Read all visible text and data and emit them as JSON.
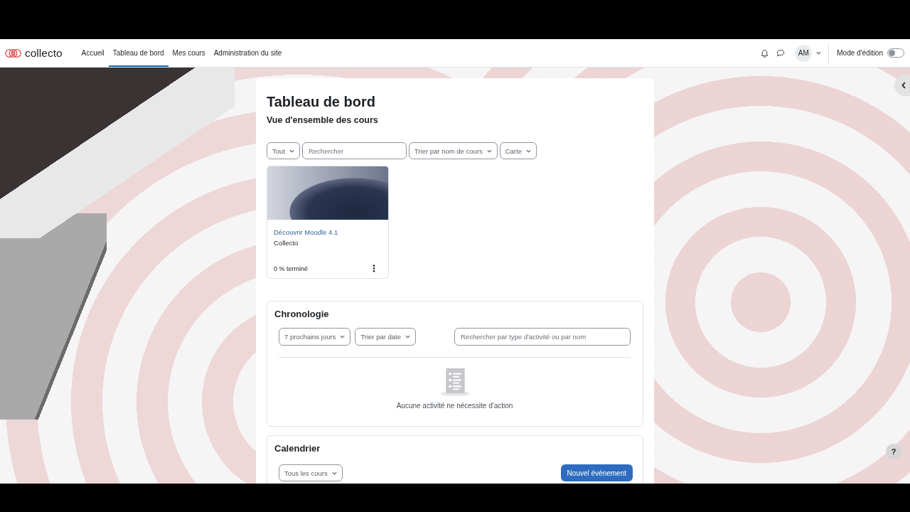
{
  "navbar": {
    "brand": "collecto",
    "links": [
      {
        "label": "Accueil",
        "selected": false
      },
      {
        "label": "Tableau de bord",
        "selected": true
      },
      {
        "label": "Mes cours",
        "selected": false
      },
      {
        "label": "Administration du site",
        "selected": false
      }
    ],
    "avatar_initials": "AM",
    "edit_mode": {
      "label": "Mode d'édition",
      "on": false
    }
  },
  "page": {
    "title": "Tableau de bord"
  },
  "course_overview": {
    "title": "Vue d'ensemble des cours",
    "filters": [
      {
        "kind": "dropdown",
        "label": "Tout"
      },
      {
        "kind": "search",
        "placeholder": "Rechercher"
      },
      {
        "kind": "dropdown",
        "label": "Trier par nom de cours"
      },
      {
        "kind": "dropdown",
        "label": "Carte"
      }
    ],
    "courses": [
      {
        "name": "Découvrir Moodle 4.1",
        "category": "Collecto",
        "progress": "0 % terminé"
      }
    ]
  },
  "timeline": {
    "title": "Chronologie",
    "filters": [
      {
        "kind": "dropdown",
        "label": "7 prochains jours"
      },
      {
        "kind": "dropdown",
        "label": "Trier par date"
      },
      {
        "kind": "search",
        "placeholder": "Rechercher par type d'activité ou par nom"
      }
    ],
    "empty_message": "Aucune activité ne nécessite d'action"
  },
  "calendar": {
    "title": "Calendrier",
    "course_filter": "Tous les cours",
    "new_event_button": "Nouvel événement"
  },
  "help_button": "?"
}
